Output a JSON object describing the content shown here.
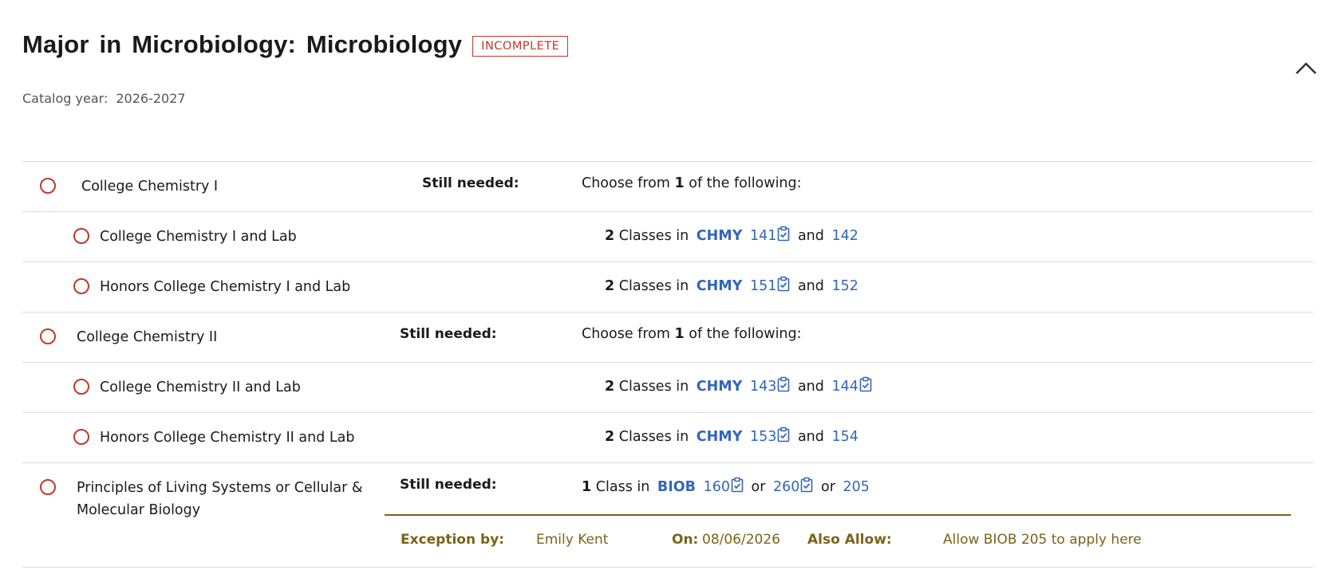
{
  "header": {
    "title": "Major in Microbiology: Microbiology",
    "status_badge": "INCOMPLETE",
    "catalog_label": "Catalog year:",
    "catalog_value": "2026-2027"
  },
  "colors": {
    "incomplete": "#c0392b",
    "link": "#3366bb",
    "exception": "#7a6418"
  },
  "rows": [
    {
      "label": "College Chemistry I",
      "still_needed": "Still needed:",
      "choose_prefix": "Choose from",
      "choose_count": "1",
      "choose_suffix": "of the following:"
    },
    {
      "label": "College Chemistry I and Lab",
      "count": "2",
      "unit": "Classes in",
      "subject": "CHMY",
      "course1": "141",
      "conj": "and",
      "course2": "142"
    },
    {
      "label": "Honors College Chemistry I and Lab",
      "count": "2",
      "unit": "Classes in",
      "subject": "CHMY",
      "course1": "151",
      "conj": "and",
      "course2": "152"
    },
    {
      "label": "College Chemistry II",
      "still_needed": "Still needed:",
      "choose_prefix": "Choose from",
      "choose_count": "1",
      "choose_suffix": "of the following:"
    },
    {
      "label": "College Chemistry II and Lab",
      "count": "2",
      "unit": "Classes in",
      "subject": "CHMY",
      "course1": "143",
      "conj": "and",
      "course2": "144"
    },
    {
      "label": "Honors College Chemistry II and Lab",
      "count": "2",
      "unit": "Classes in",
      "subject": "CHMY",
      "course1": "153",
      "conj": "and",
      "course2": "154"
    },
    {
      "label": "Principles of Living Systems or Cellular & Molecular Biology",
      "still_needed": "Still needed:",
      "count": "1",
      "unit": "Class in",
      "subject": "BIOB",
      "course1": "160",
      "conj1": "or",
      "course2": "260",
      "conj2": "or",
      "course3": "205",
      "exception": {
        "by_label": "Exception by:",
        "by_value": "Emily Kent",
        "on_label": "On:",
        "on_value": "08/06/2026",
        "allow_label": "Also Allow:",
        "allow_value": "Allow BIOB 205 to apply here"
      }
    }
  ]
}
